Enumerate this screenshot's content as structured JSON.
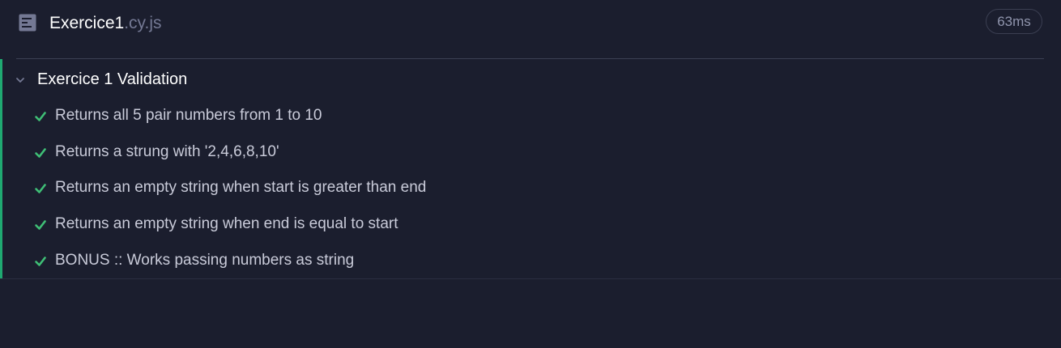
{
  "colors": {
    "background": "#1b1e2e",
    "pass_green": "#1fa971",
    "check_green": "#3fbf76",
    "muted": "#747994"
  },
  "spec": {
    "icon": "document-icon",
    "file_name": "Exercice1",
    "file_extension": ".cy.js",
    "duration": "63ms"
  },
  "suite": {
    "chevron_icon": "chevron-down-icon",
    "title": "Exercice 1 Validation",
    "status": "passed",
    "tests": [
      {
        "label": "Returns all 5 pair numbers from 1 to 10",
        "status": "passed",
        "icon": "check-icon"
      },
      {
        "label": "Returns a strung with '2,4,6,8,10'",
        "status": "passed",
        "icon": "check-icon"
      },
      {
        "label": "Returns an empty string when start is greater than end",
        "status": "passed",
        "icon": "check-icon"
      },
      {
        "label": "Returns an empty string when end is equal to start",
        "status": "passed",
        "icon": "check-icon"
      },
      {
        "label": "BONUS :: Works passing numbers as string",
        "status": "passed",
        "icon": "check-icon"
      }
    ]
  }
}
